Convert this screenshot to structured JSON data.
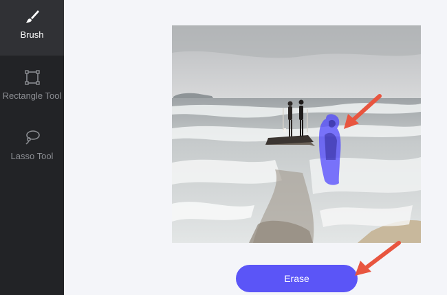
{
  "sidebar": {
    "tools": [
      {
        "label": "Brush",
        "icon": "brush-icon",
        "active": true
      },
      {
        "label": "Rectangle Tool",
        "icon": "rectangle-select-icon",
        "active": false
      },
      {
        "label": "Lasso Tool",
        "icon": "lasso-icon",
        "active": false
      }
    ]
  },
  "canvas": {
    "image": "beach-photo",
    "mask": "brush-mask-highlight"
  },
  "actions": {
    "erase_label": "Erase"
  },
  "colors": {
    "sidebar_bg": "#222326",
    "active_tool_bg": "#303135",
    "accent": "#5b55f7",
    "mask": "#4b43ff",
    "annotation_arrow": "#e8553f"
  }
}
